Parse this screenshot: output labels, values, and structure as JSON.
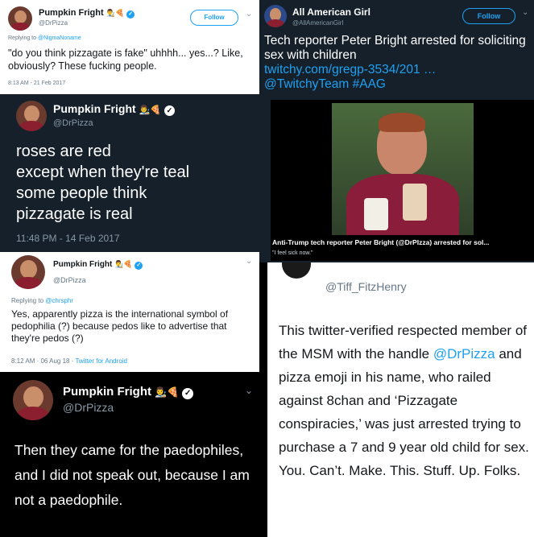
{
  "p1": {
    "name": "Pumpkin Fright",
    "emojis": "👨‍🎨🍕",
    "handle": "@DrPizza",
    "follow": "Follow",
    "replying_prefix": "Replying to ",
    "replying_to": "@NigmaNoname",
    "text": "\"do you think pizzagate is fake\" uhhhh... yes...? Like, obviously? These fucking people.",
    "time": "8:13 AM - 21 Feb 2017"
  },
  "p2": {
    "name": "All American Girl",
    "handle": "@AllAmericanGirl",
    "follow": "Follow",
    "text": "Tech reporter Peter Bright arrested for soliciting sex with children",
    "link": "twitchy.com/gregp-3534/201 …",
    "mention_tags": "@TwitchyTeam #AAG",
    "card_title": "Anti-Trump tech reporter Peter Bright (@DrPIzza) arrested for sol...",
    "card_sub": "\"I feel sick now.\""
  },
  "p3": {
    "name": "Pumpkin Fright",
    "emojis": "👨‍🎨🍕",
    "handle": "@DrPizza",
    "lines": [
      "roses are red",
      "except when they're teal",
      "some people think",
      "pizzagate is real"
    ],
    "time": "11:48 PM - 14 Feb 2017"
  },
  "p4": {
    "name": "Pumpkin Fright",
    "emojis": "👨‍🎨🍕",
    "handle": "@DrPizza",
    "replying_prefix": "Replying to ",
    "replying_to": "@chrsphr",
    "text": "Yes, apparently pizza is the international symbol of pedophilia (?) because pedos like to advertise that they're pedos (?)",
    "time": "8:12 AM · 06 Aug 18 · ",
    "client": "Twitter for Android"
  },
  "p5": {
    "handle": "@Tiff_FitzHenry",
    "text_before": "This twitter-verified respected member of the MSM with the handle ",
    "text_mention": "@DrPizza",
    "text_after": " and pizza emoji in his name, who railed against 8chan and ‘Pizzagate conspiracies,’ was just arrested trying to purchase a 7 and 9 year old child for sex. You. Can’t. Make. This. Stuff. Up. Folks."
  },
  "p6": {
    "name": "Pumpkin Fright",
    "emojis": "👨‍🎨🍕",
    "handle": "@DrPizza",
    "text": "Then they came for the paedophiles, and I did not speak out, because I am not a paedophile."
  },
  "colors": {
    "twitter_blue": "#1da1f2",
    "dark_bg": "#15202b"
  }
}
